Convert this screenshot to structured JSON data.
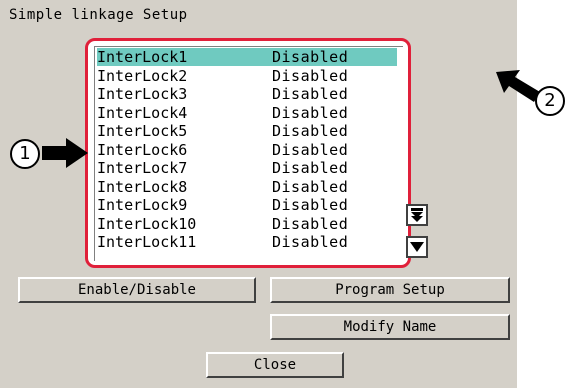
{
  "dialog": {
    "title": "Simple linkage Setup"
  },
  "interlocks": [
    {
      "name": "InterLock1",
      "status": "Disabled"
    },
    {
      "name": "InterLock2",
      "status": "Disabled"
    },
    {
      "name": "InterLock3",
      "status": "Disabled"
    },
    {
      "name": "InterLock4",
      "status": "Disabled"
    },
    {
      "name": "InterLock5",
      "status": "Disabled"
    },
    {
      "name": "InterLock6",
      "status": "Disabled"
    },
    {
      "name": "InterLock7",
      "status": "Disabled"
    },
    {
      "name": "InterLock8",
      "status": "Disabled"
    },
    {
      "name": "InterLock9",
      "status": "Disabled"
    },
    {
      "name": "InterLock10",
      "status": "Disabled"
    },
    {
      "name": "InterLock11",
      "status": "Disabled"
    }
  ],
  "selected_index": 0,
  "buttons": {
    "enable_disable": "Enable/Disable",
    "program_setup": "Program Setup",
    "modify_name": "Modify Name",
    "close": "Close"
  },
  "callouts": {
    "one": "1",
    "two": "2"
  },
  "colors": {
    "selection": "#6fcac0",
    "highlight_frame": "#e0203a",
    "panel": "#d4d0c8"
  },
  "icons": {
    "scroll_fast_down": "double-chevron-down-icon",
    "scroll_down": "chevron-down-icon",
    "pointer": "arrow-icon"
  }
}
